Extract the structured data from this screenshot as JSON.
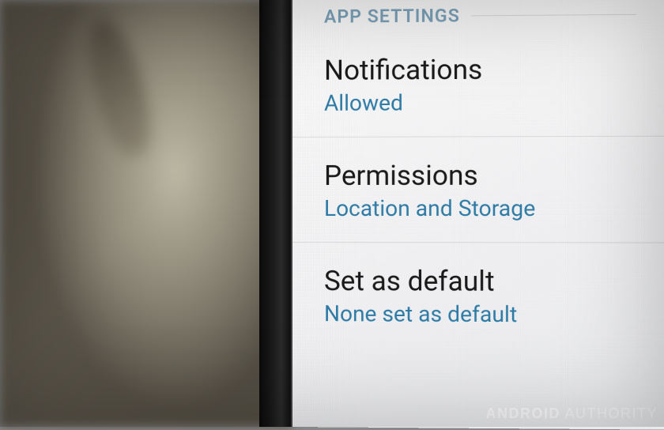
{
  "section_header": "APP SETTINGS",
  "settings": [
    {
      "title": "Notifications",
      "value": "Allowed"
    },
    {
      "title": "Permissions",
      "value": "Location and Storage"
    },
    {
      "title": "Set as default",
      "value": "None set as default"
    }
  ],
  "watermark": {
    "brand": "ANDROID",
    "suffix": "AUTHORITY"
  }
}
